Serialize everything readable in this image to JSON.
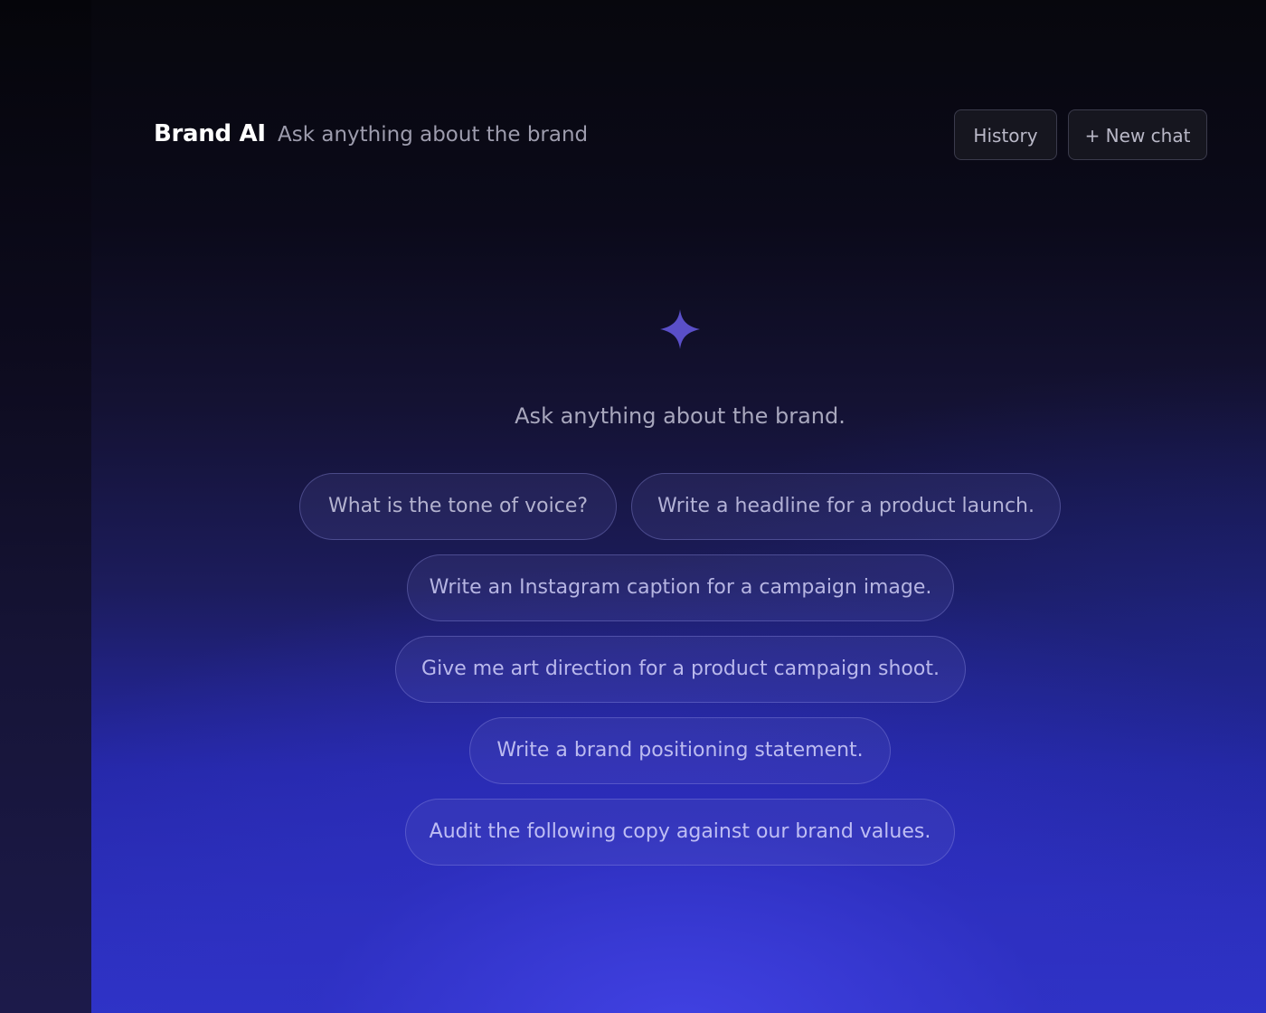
{
  "header": {
    "title": "Brand AI",
    "subtitle": "Ask anything about the brand",
    "history_label": "History",
    "new_chat_label": "+ New chat"
  },
  "empty_state": {
    "icon": "sparkle-icon",
    "heading": "Ask anything about the brand."
  },
  "suggestions": [
    "What is the tone of voice?",
    "Write a headline for a product launch.",
    "Write an Instagram caption for a campaign image.",
    "Give me art direction for a product campaign shoot.",
    "Write a brand positioning statement.",
    "Audit the following copy against our brand values."
  ],
  "colors": {
    "accent": "#5a4fc8",
    "background_top": "#07070d",
    "background_bottom": "#3b3fd8",
    "chip_border": "#6e6ec0",
    "button_bg": "#16161f"
  }
}
